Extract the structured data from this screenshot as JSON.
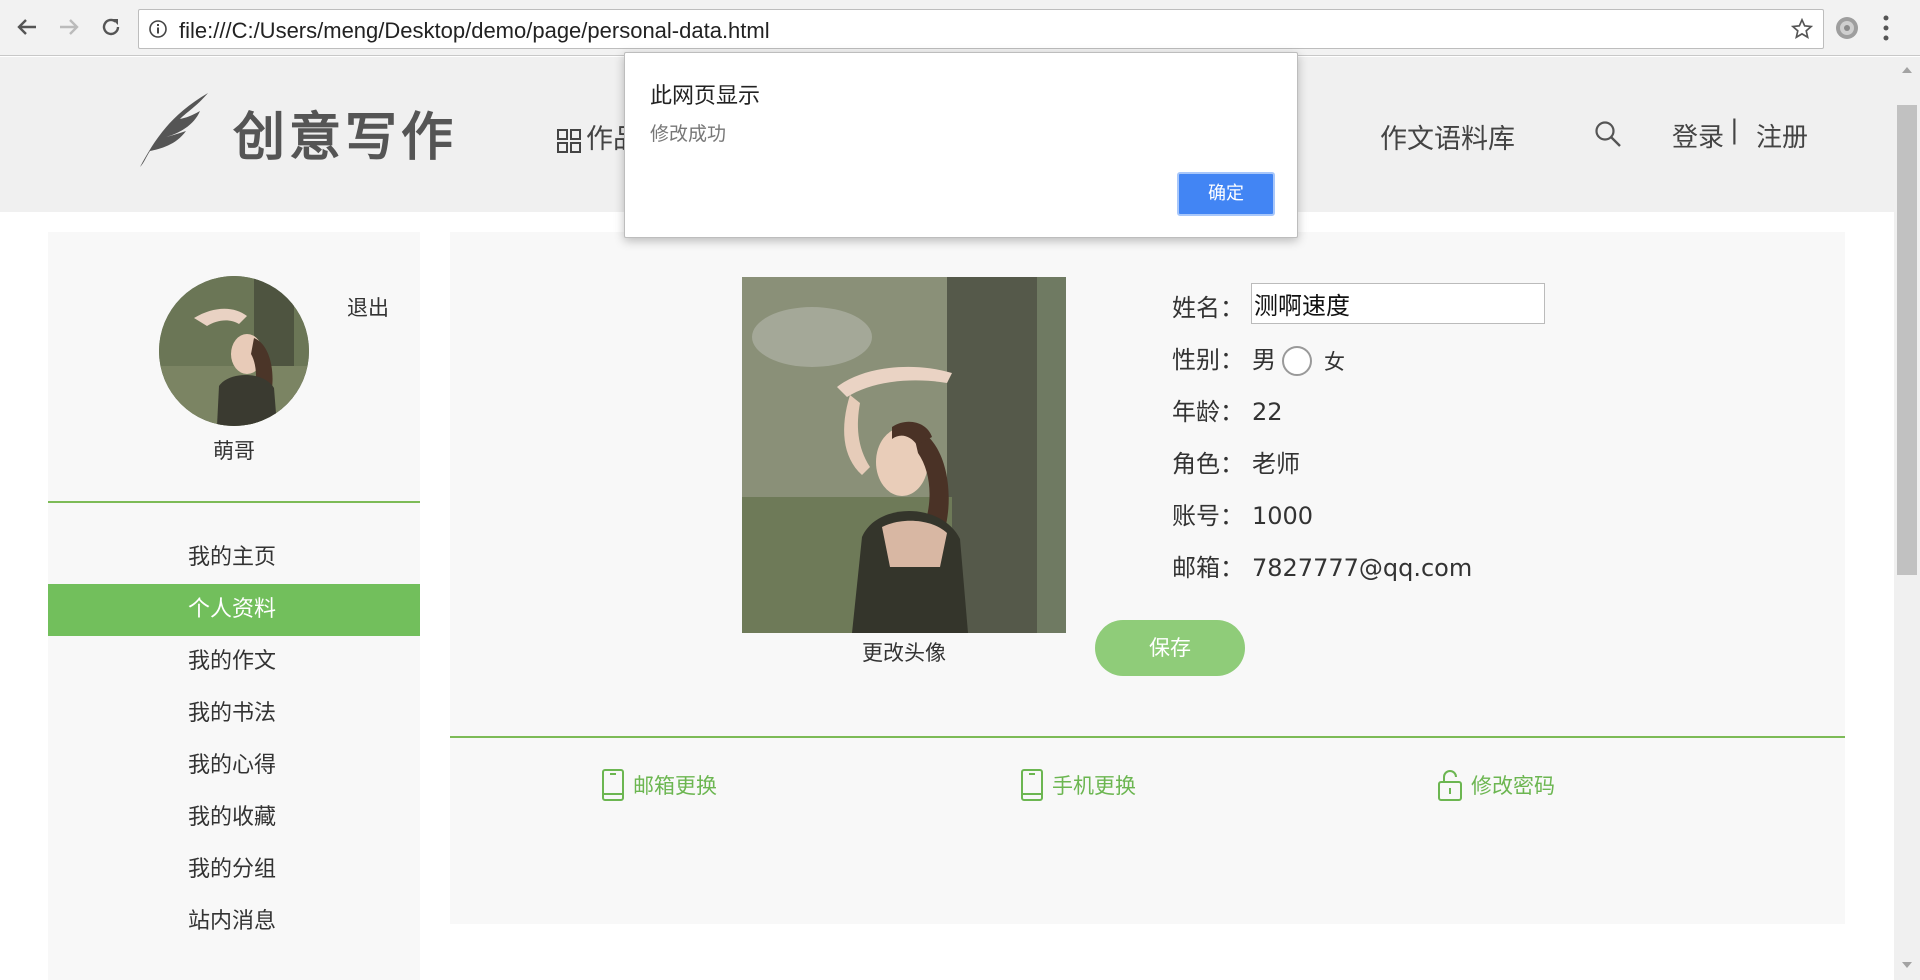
{
  "browser": {
    "url": "file:///C:/Users/meng/Desktop/demo/page/personal-data.html"
  },
  "header": {
    "logo_text": "创意写作",
    "nav_works_visible": "作品",
    "nav_corpus": "作文语料库",
    "login": "登录",
    "separator": "|",
    "register": "注册"
  },
  "sidebar": {
    "logout": "退出",
    "username": "萌哥",
    "items": [
      {
        "label": "我的主页",
        "active": false
      },
      {
        "label": "个人资料",
        "active": true
      },
      {
        "label": "我的作文",
        "active": false
      },
      {
        "label": "我的书法",
        "active": false
      },
      {
        "label": "我的心得",
        "active": false
      },
      {
        "label": "我的收藏",
        "active": false
      },
      {
        "label": "我的分组",
        "active": false
      },
      {
        "label": "站内消息",
        "active": false
      }
    ]
  },
  "profile": {
    "change_avatar": "更改头像",
    "save": "保存",
    "name_label": "姓名：",
    "name_value": "测啊速度",
    "gender_label": "性别：",
    "gender_male": "男",
    "gender_female": "女",
    "age_label": "年龄：",
    "age_value": "22",
    "role_label": "角色：",
    "role_value": "老师",
    "account_label": "账号：",
    "account_value": "1000",
    "email_label": "邮箱：",
    "email_value": "7827777@qq.com"
  },
  "links": {
    "email_change": "邮箱更换",
    "phone_change": "手机更换",
    "password_change": "修改密码"
  },
  "dialog": {
    "title": "此网页显示",
    "message": "修改成功",
    "ok": "确定"
  },
  "colors": {
    "accent_green": "#72bf5c",
    "save_green": "#8fcc79",
    "dialog_blue": "#4285f4"
  }
}
